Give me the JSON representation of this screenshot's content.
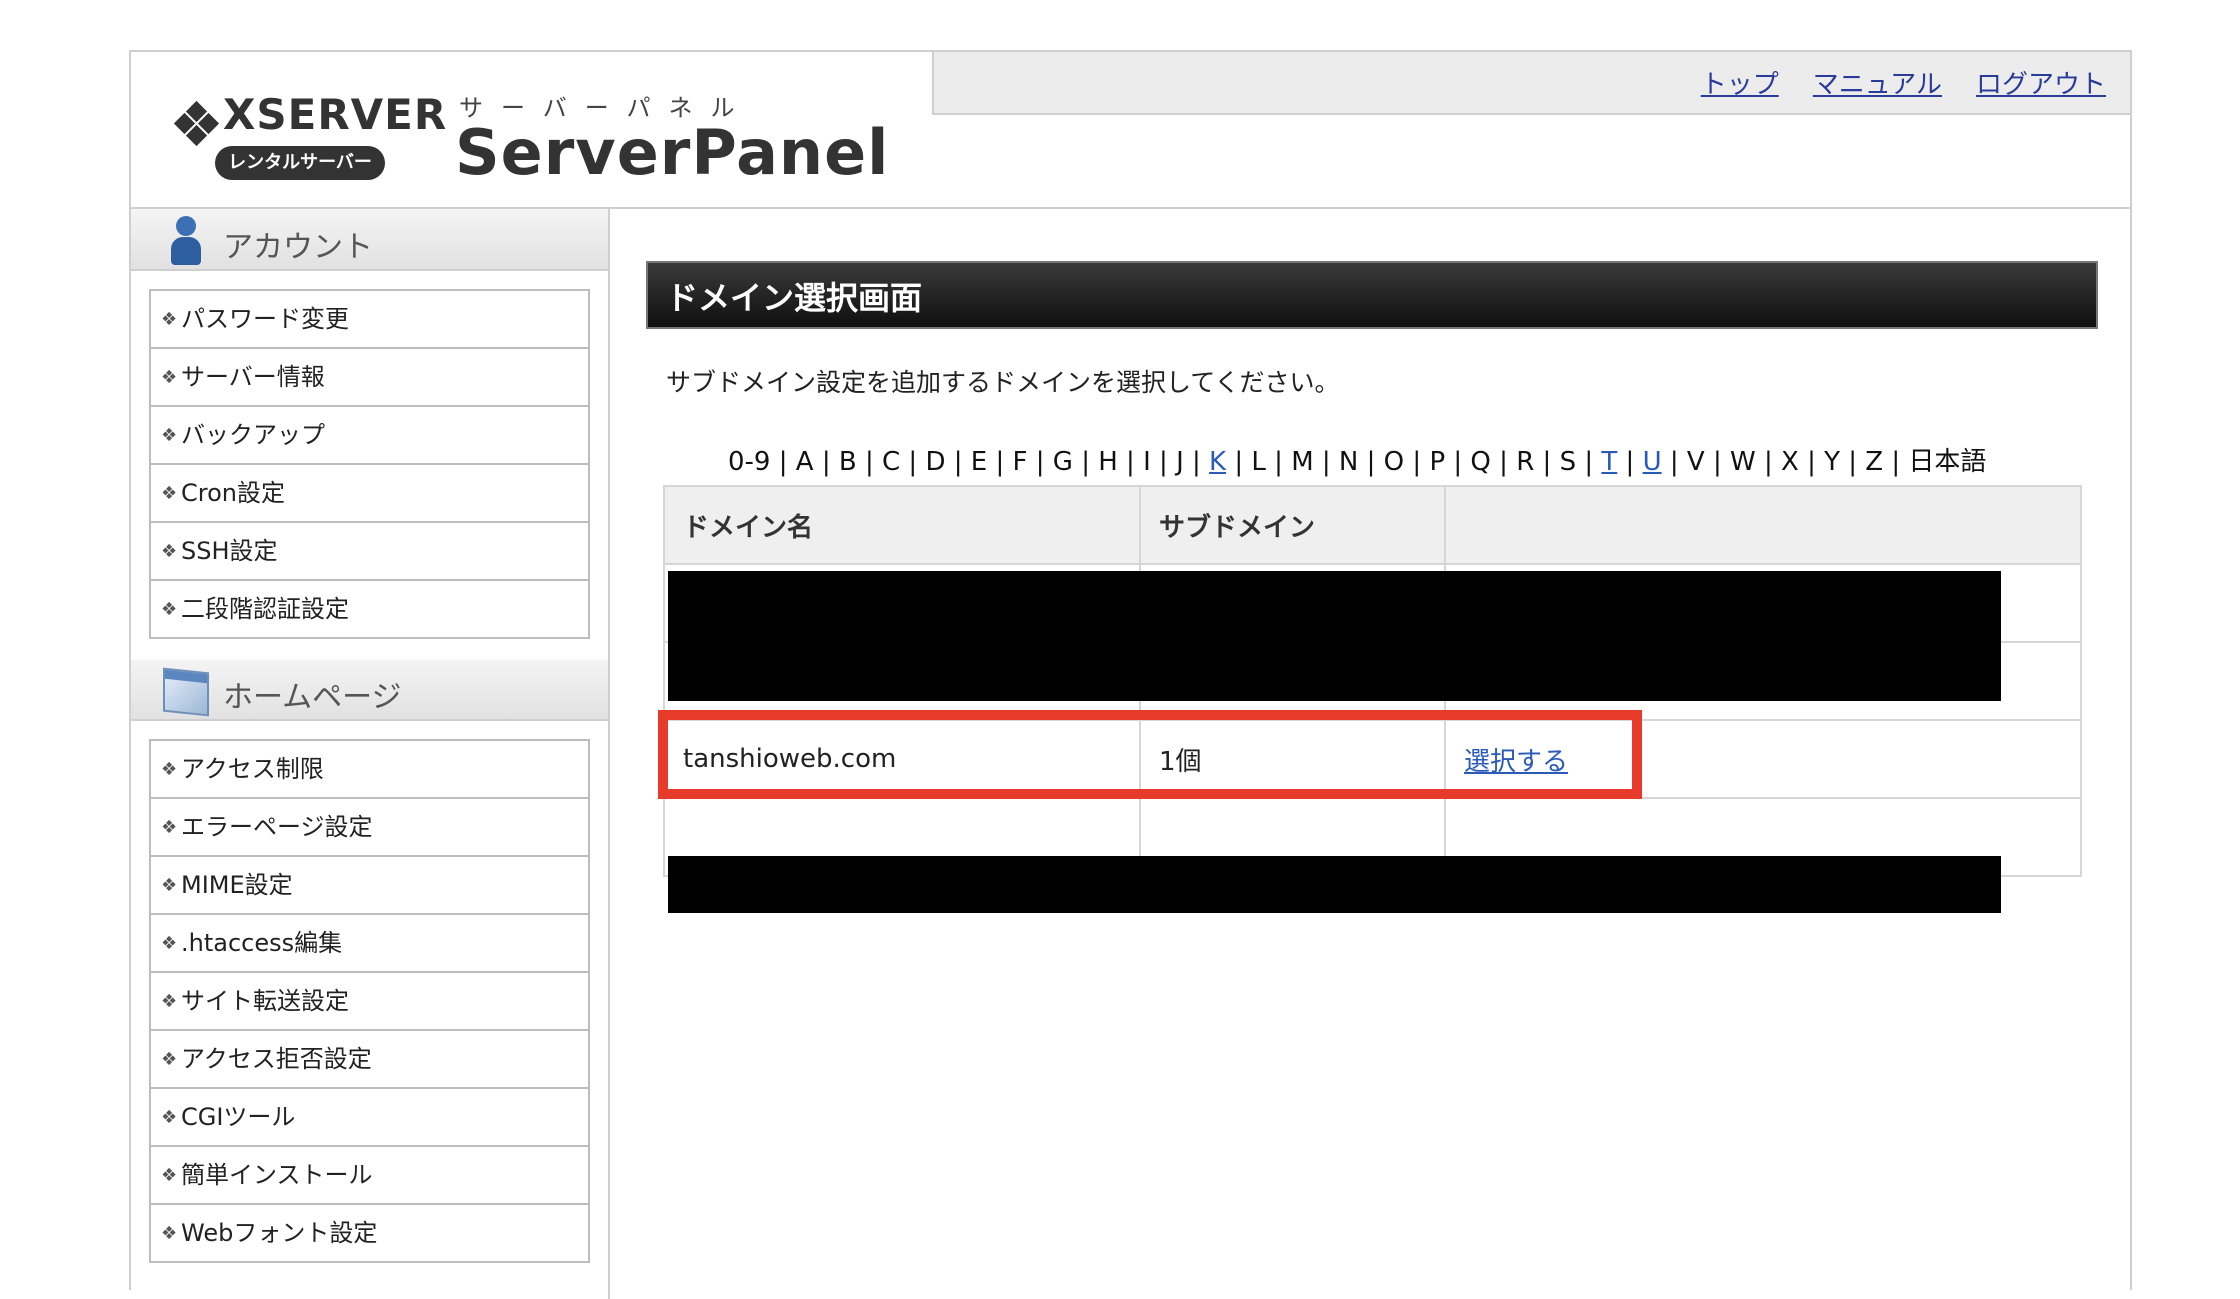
{
  "header": {
    "brand_word": "XSERVER",
    "brand_pill": "レンタルサーバー",
    "panel_sub": "サーバーパネル",
    "panel_title": "ServerPanel",
    "nav": [
      "トップ",
      "マニュアル",
      "ログアウト"
    ]
  },
  "sidebar": {
    "sections": [
      {
        "title": "アカウント",
        "icon": "account-icon",
        "items": [
          "パスワード変更",
          "サーバー情報",
          "バックアップ",
          "Cron設定",
          "SSH設定",
          "二段階認証設定"
        ]
      },
      {
        "title": "ホームページ",
        "icon": "homepage-icon",
        "items": [
          "アクセス制限",
          "エラーページ設定",
          "MIME設定",
          ".htaccess編集",
          "サイト転送設定",
          "アクセス拒否設定",
          "CGIツール",
          "簡単インストール",
          "Webフォント設定"
        ]
      }
    ]
  },
  "main": {
    "title": "ドメイン選択画面",
    "intro": "サブドメイン設定を追加するドメインを選択してください。",
    "index": [
      {
        "t": "0-9",
        "link": false
      },
      {
        "t": "A",
        "link": false
      },
      {
        "t": "B",
        "link": false
      },
      {
        "t": "C",
        "link": false
      },
      {
        "t": "D",
        "link": false
      },
      {
        "t": "E",
        "link": false
      },
      {
        "t": "F",
        "link": false
      },
      {
        "t": "G",
        "link": false
      },
      {
        "t": "H",
        "link": false
      },
      {
        "t": "I",
        "link": false
      },
      {
        "t": "J",
        "link": false
      },
      {
        "t": "K",
        "link": true
      },
      {
        "t": "L",
        "link": false
      },
      {
        "t": "M",
        "link": false
      },
      {
        "t": "N",
        "link": false
      },
      {
        "t": "O",
        "link": false
      },
      {
        "t": "P",
        "link": false
      },
      {
        "t": "Q",
        "link": false
      },
      {
        "t": "R",
        "link": false
      },
      {
        "t": "S",
        "link": false
      },
      {
        "t": "T",
        "link": true
      },
      {
        "t": "U",
        "link": true
      },
      {
        "t": "V",
        "link": false
      },
      {
        "t": "W",
        "link": false
      },
      {
        "t": "X",
        "link": false
      },
      {
        "t": "Y",
        "link": false
      },
      {
        "t": "Z",
        "link": false
      },
      {
        "t": "日本語",
        "link": false
      }
    ],
    "table": {
      "headers": [
        "ドメイン名",
        "サブドメイン",
        ""
      ],
      "visible_row": {
        "domain": "tanshioweb.com",
        "subdomains": "1個",
        "action": "選択する"
      }
    }
  },
  "colors": {
    "link": "#2a5ab8",
    "highlight": "#e63a2a",
    "title_bar": "#1a1a1a"
  }
}
